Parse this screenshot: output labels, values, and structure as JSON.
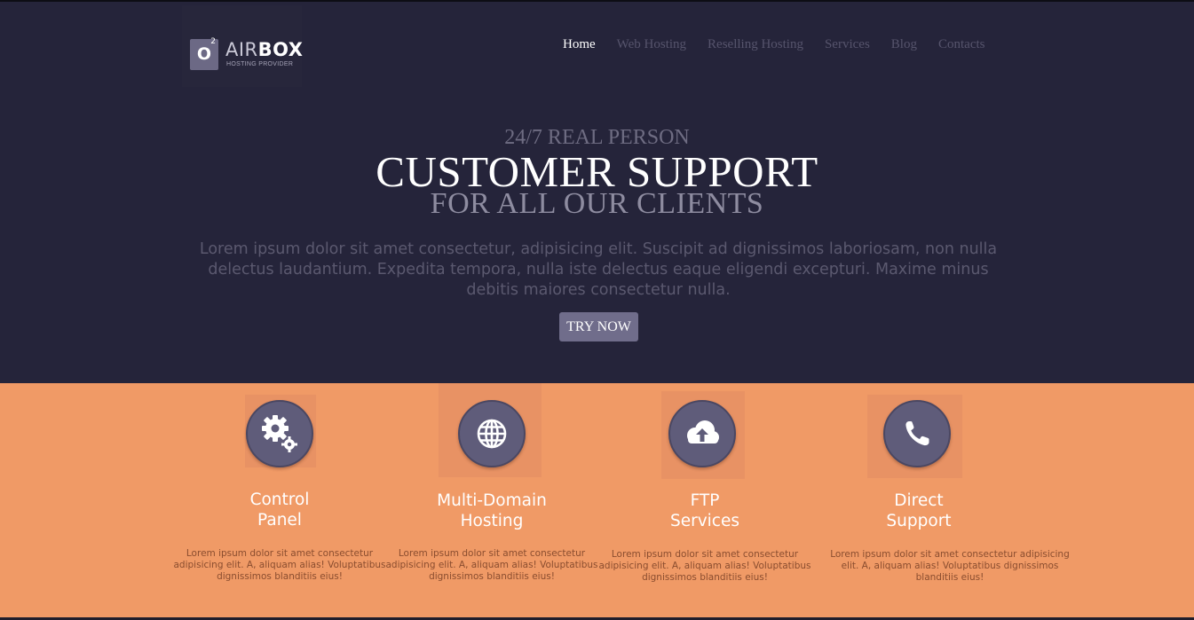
{
  "logo": {
    "badge": "O",
    "badge_sup": "2",
    "name_light": "AIR",
    "name_bold": "BOX",
    "tagline": "HOSTING PROVIDER"
  },
  "nav": {
    "items": [
      {
        "label": "Home",
        "active": true
      },
      {
        "label": "Web Hosting",
        "active": false
      },
      {
        "label": "Reselling Hosting",
        "active": false
      },
      {
        "label": "Services",
        "active": false
      },
      {
        "label": "Blog",
        "active": false
      },
      {
        "label": "Contacts",
        "active": false
      }
    ]
  },
  "hero": {
    "line1": "24/7 REAL PERSON",
    "line2": "CUSTOMER SUPPORT",
    "line3": "FOR ALL OUR CLIENTS",
    "lead": "Lorem ipsum dolor sit amet consectetur, adipisicing elit. Suscipit ad dignissimos laboriosam, non nulla delectus laudantium. Expedita tempora, nulla iste delectus eaque eligendi excepturi. Maxime minus debitis maiores consectetur nulla.",
    "button": "TRY NOW"
  },
  "features": [
    {
      "icon": "gears-icon",
      "title_1": "Control",
      "title_2": "Panel",
      "text": "Lorem ipsum dolor sit amet consectetur adipisicing elit. A, aliquam alias! Voluptatibus dignissimos blanditiis eius!"
    },
    {
      "icon": "globe-icon",
      "title_1": "Multi-Domain",
      "title_2": "Hosting",
      "text": "Lorem ipsum dolor sit amet consectetur adipisicing elit. A, aliquam alias! Voluptatibus dignissimos blanditiis eius!"
    },
    {
      "icon": "cloud-upload-icon",
      "title_1": "FTP",
      "title_2": "Services",
      "text": "Lorem ipsum dolor sit amet consectetur adipisicing elit. A, aliquam alias! Voluptatibus dignissimos blanditiis eius!"
    },
    {
      "icon": "phone-icon",
      "title_1": "Direct",
      "title_2": "Support",
      "text": "Lorem ipsum dolor sit amet consectetur adipisicing elit. A, aliquam alias! Voluptatibus dignissimos blanditiis eius!"
    }
  ],
  "colors": {
    "hero_bg": "#25243a",
    "features_bg": "#f09a66",
    "button_bg": "#706d8b",
    "icon_circle": "#5f5c7a"
  }
}
